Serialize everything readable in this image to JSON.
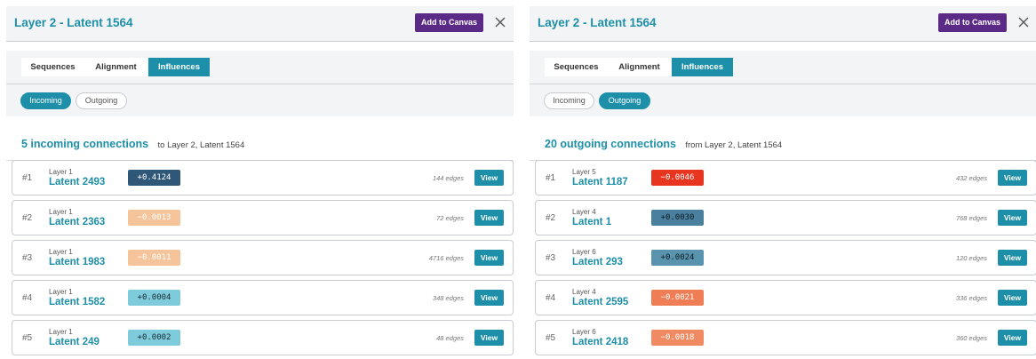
{
  "panels": [
    {
      "title": "Layer 2 - Latent 1564",
      "add_label": "Add to Canvas",
      "tabs": [
        "Sequences",
        "Alignment",
        "Influences"
      ],
      "active_tab": "Influences",
      "pills": [
        "Incoming",
        "Outgoing"
      ],
      "active_pill": "Incoming",
      "summary_count": "5 incoming connections",
      "summary_context": "to Layer 2, Latent 1564",
      "rows": [
        {
          "rank": "#1",
          "layer": "Layer 1",
          "latent": "Latent 2493",
          "weight": "+0.4124",
          "edges": "144 edges",
          "bg": "#2f5878",
          "fg": "#ffffff"
        },
        {
          "rank": "#2",
          "layer": "Layer 1",
          "latent": "Latent 2363",
          "weight": "−0.0013",
          "edges": "72 edges",
          "bg": "#f5c49a",
          "fg": "#ffffff"
        },
        {
          "rank": "#3",
          "layer": "Layer 1",
          "latent": "Latent 1983",
          "weight": "−0.0011",
          "edges": "4716 edges",
          "bg": "#f5c49a",
          "fg": "#ffffff"
        },
        {
          "rank": "#4",
          "layer": "Layer 1",
          "latent": "Latent 1582",
          "weight": "+0.0004",
          "edges": "348 edges",
          "bg": "#7ecbdc",
          "fg": "#1a2a33"
        },
        {
          "rank": "#5",
          "layer": "Layer 1",
          "latent": "Latent 249",
          "weight": "+0.0002",
          "edges": "48 edges",
          "bg": "#7ecbdc",
          "fg": "#1a2a33"
        }
      ]
    },
    {
      "title": "Layer 2 - Latent 1564",
      "add_label": "Add to Canvas",
      "tabs": [
        "Sequences",
        "Alignment",
        "Influences"
      ],
      "active_tab": "Influences",
      "pills": [
        "Incoming",
        "Outgoing"
      ],
      "active_pill": "Outgoing",
      "summary_count": "20 outgoing connections",
      "summary_context": "from Layer 2, Latent 1564",
      "rows": [
        {
          "rank": "#1",
          "layer": "Layer 5",
          "latent": "Latent 1187",
          "weight": "−0.0046",
          "edges": "432 edges",
          "bg": "#e8351f",
          "fg": "#ffffff"
        },
        {
          "rank": "#2",
          "layer": "Layer 4",
          "latent": "Latent 1",
          "weight": "+0.0030",
          "edges": "768 edges",
          "bg": "#4a7f9e",
          "fg": "#0d1b24"
        },
        {
          "rank": "#3",
          "layer": "Layer 6",
          "latent": "Latent 293",
          "weight": "+0.0024",
          "edges": "120 edges",
          "bg": "#5a93ad",
          "fg": "#0d1b24"
        },
        {
          "rank": "#4",
          "layer": "Layer 4",
          "latent": "Latent 2595",
          "weight": "−0.0021",
          "edges": "336 edges",
          "bg": "#ef7d55",
          "fg": "#ffffff"
        },
        {
          "rank": "#5",
          "layer": "Layer 6",
          "latent": "Latent 2418",
          "weight": "−0.0018",
          "edges": "360 edges",
          "bg": "#f08a62",
          "fg": "#ffffff"
        }
      ]
    }
  ],
  "colors": {
    "accent": "#1d8fa8",
    "add_button": "#5b2a86",
    "header_bg": "#f2f4f6"
  },
  "icons": {
    "close": "close-icon"
  }
}
